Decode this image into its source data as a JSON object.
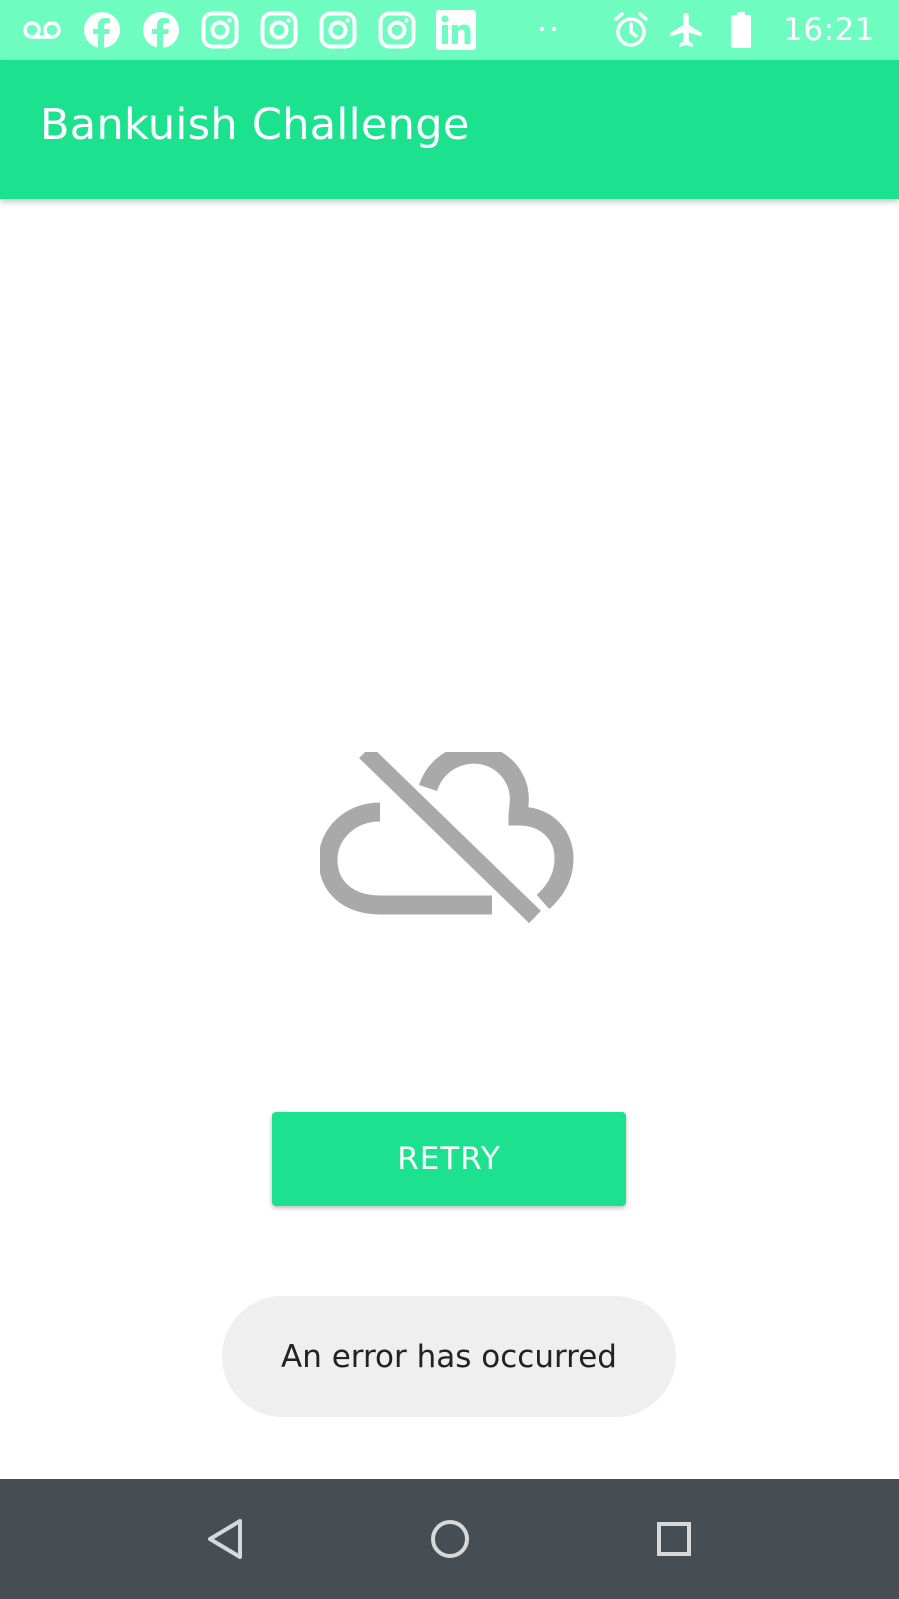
{
  "status_bar": {
    "time": "16:21",
    "background_color": "#6efcc0",
    "left_icons": [
      "voicemail-icon",
      "facebook-icon",
      "facebook-icon",
      "instagram-icon",
      "instagram-icon",
      "instagram-icon",
      "instagram-icon",
      "linkedin-icon"
    ],
    "overflow_indicator": "more-notifications-dots-icon",
    "right_icons": [
      "alarm-icon",
      "airplane-mode-icon",
      "battery-full-icon"
    ]
  },
  "app_bar": {
    "title": "Bankuish Challenge",
    "background_color": "#1ce290"
  },
  "main": {
    "illustration_icon": "cloud-off-icon",
    "illustration_color": "#a9a9a9",
    "retry_label": "RETRY",
    "retry_color": "#1ce290"
  },
  "toast": {
    "message": "An error has occurred"
  },
  "nav_bar": {
    "background_color": "#464d53",
    "buttons": [
      "back-icon",
      "home-icon",
      "recents-icon"
    ]
  }
}
